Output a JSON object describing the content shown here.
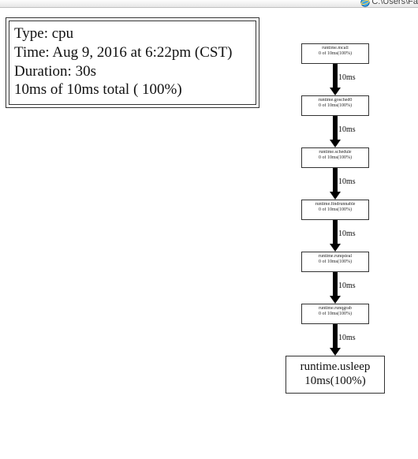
{
  "topbar": {
    "ie_fragment": "C:\\Users\\Fa"
  },
  "infobox": {
    "type_line": "Type: cpu",
    "time_line": "Time: Aug 9, 2016 at 6:22pm (CST)",
    "duration_line": "Duration: 30s",
    "total_line": "10ms of 10ms total (   100%)"
  },
  "graph": {
    "nodes": [
      {
        "id": "n0",
        "label1": "runtime.mcall",
        "label2": "0 of 10ms(100%)",
        "size": "small"
      },
      {
        "id": "n1",
        "label1": "runtime.gosched0",
        "label2": "0 of 10ms(100%)",
        "size": "small"
      },
      {
        "id": "n2",
        "label1": "runtime.schedule",
        "label2": "0 of 10ms(100%)",
        "size": "small"
      },
      {
        "id": "n3",
        "label1": "runtime.findrunnable",
        "label2": "0 of 10ms(100%)",
        "size": "small"
      },
      {
        "id": "n4",
        "label1": "runtime.runqsteal",
        "label2": "0 of 10ms(100%)",
        "size": "small"
      },
      {
        "id": "n5",
        "label1": "runtime.runqgrab",
        "label2": "0 of 10ms(100%)",
        "size": "small"
      },
      {
        "id": "n6",
        "label1": "runtime.usleep",
        "label2": "10ms(100%)",
        "size": "big"
      }
    ],
    "edges": [
      {
        "from": "n0",
        "to": "n1",
        "label": "10ms"
      },
      {
        "from": "n1",
        "to": "n2",
        "label": "10ms"
      },
      {
        "from": "n2",
        "to": "n3",
        "label": "10ms"
      },
      {
        "from": "n3",
        "to": "n4",
        "label": "10ms"
      },
      {
        "from": "n4",
        "to": "n5",
        "label": "10ms"
      },
      {
        "from": "n5",
        "to": "n6",
        "label": "10ms"
      }
    ]
  }
}
